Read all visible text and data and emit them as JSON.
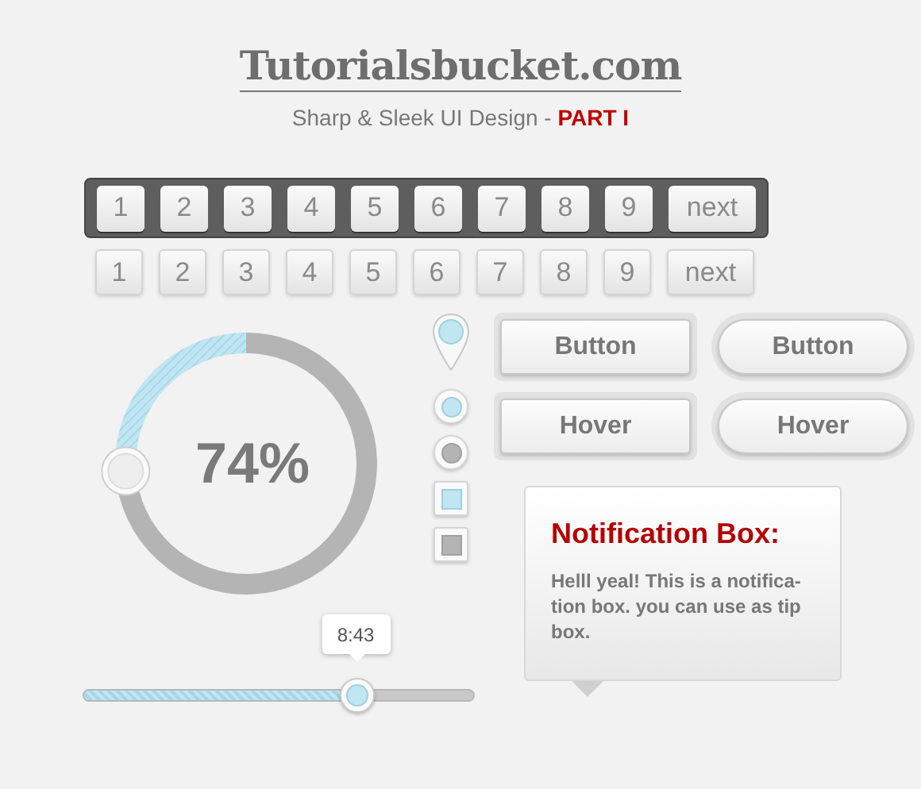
{
  "header": {
    "title": "Tutorialsbucket.com",
    "subtitle": "Sharp & Sleek UI Design - ",
    "subtitle_highlight": "PART I"
  },
  "pagination_dark": {
    "pages": [
      "1",
      "2",
      "3",
      "4",
      "5",
      "6",
      "7",
      "8",
      "9"
    ],
    "next": "next"
  },
  "pagination_light": {
    "pages": [
      "1",
      "2",
      "3",
      "4",
      "5",
      "6",
      "7",
      "8",
      "9"
    ],
    "next": "next"
  },
  "dial": {
    "reading": "74%"
  },
  "controls": [
    {
      "kind": "radio",
      "selected": true
    },
    {
      "kind": "radio",
      "selected": false
    },
    {
      "kind": "checkbox",
      "checked": true
    },
    {
      "kind": "checkbox",
      "checked": false
    }
  ],
  "buttons": [
    {
      "label": "Button",
      "kind": "square"
    },
    {
      "label": "Button",
      "kind": "pill"
    },
    {
      "label": "Hover",
      "kind": "square"
    },
    {
      "label": "Hover",
      "kind": "pill"
    }
  ],
  "slider": {
    "tooltip": "8:43",
    "level": 0.7
  },
  "notification": {
    "title": "Notification Box:",
    "body": "Helll yeal! This is a notifica-tion box. you can use as tip box."
  }
}
